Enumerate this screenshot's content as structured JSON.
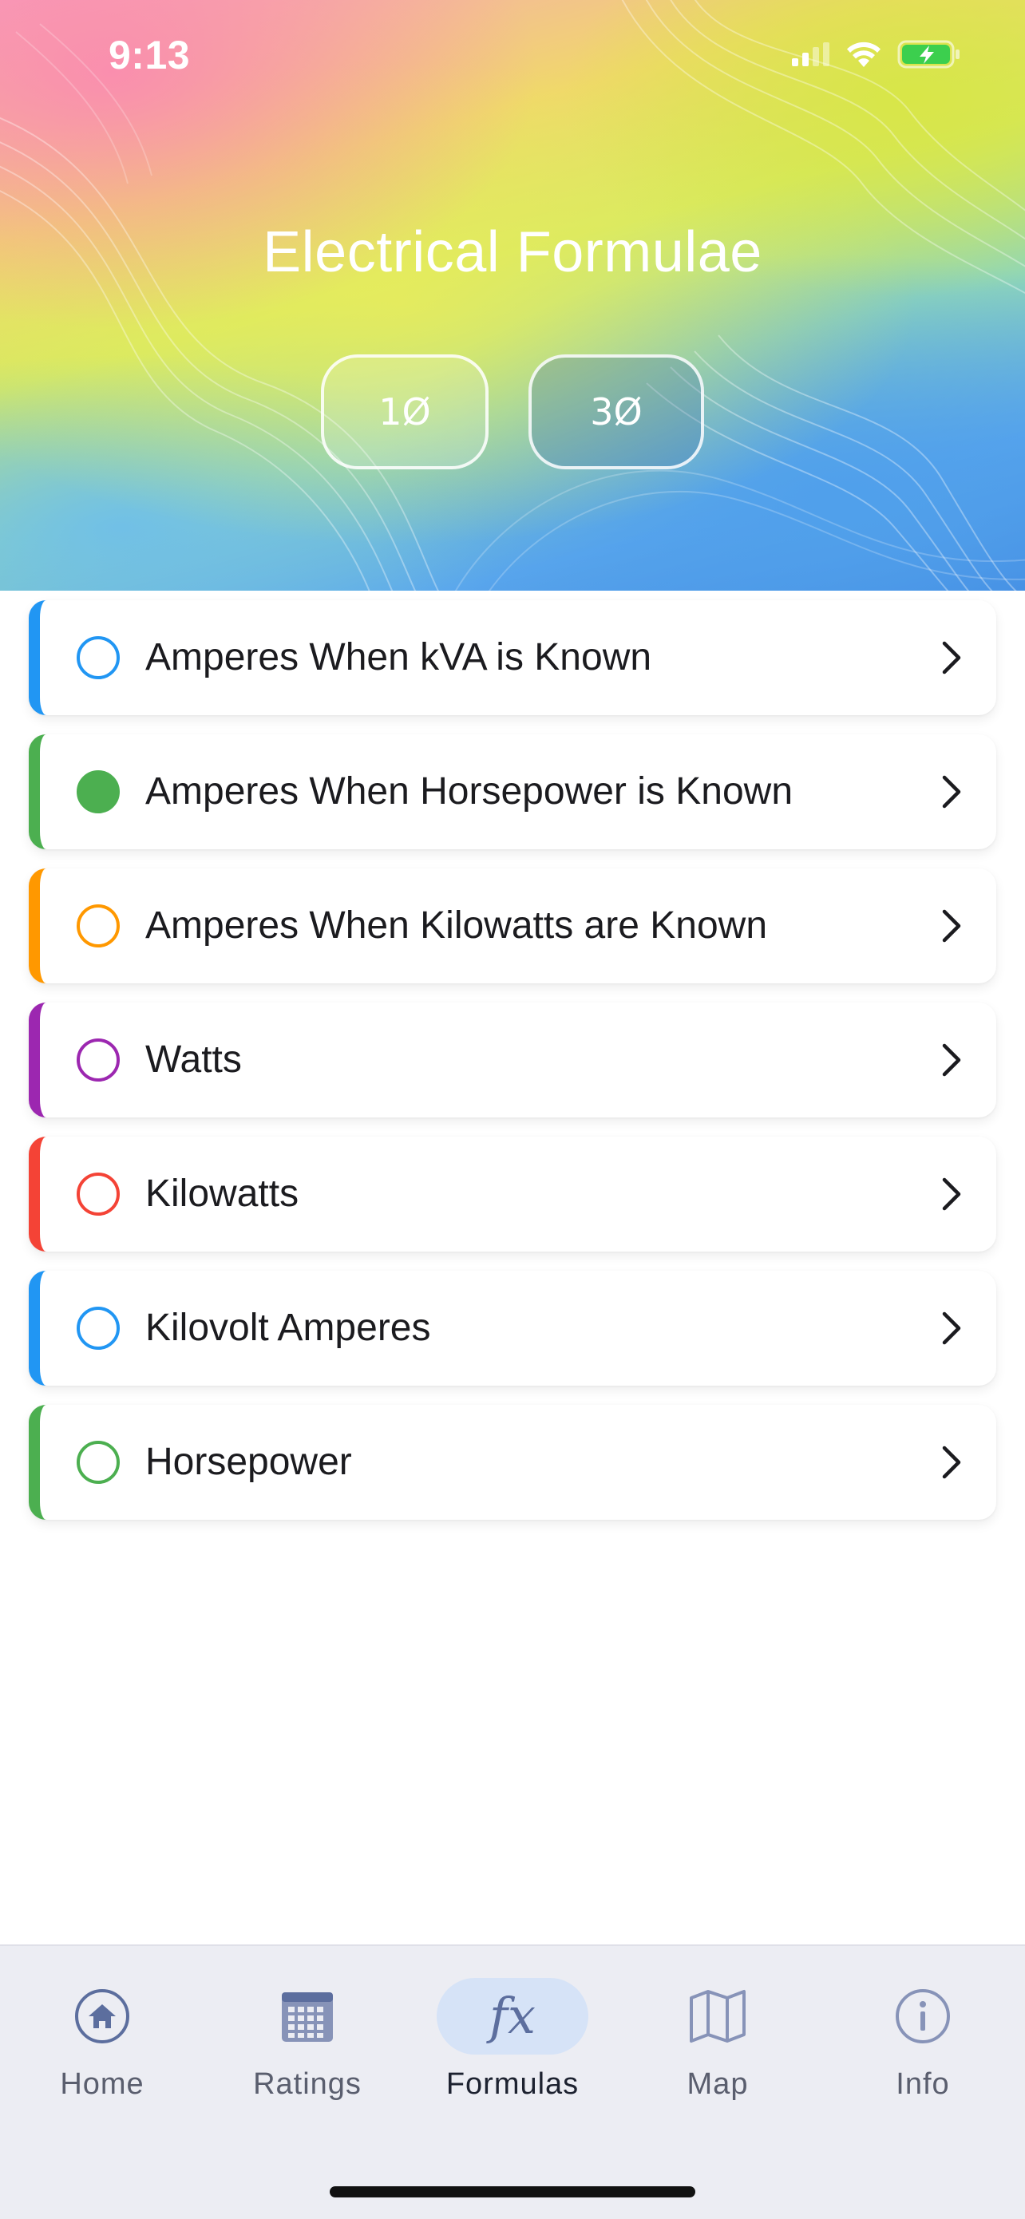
{
  "status_bar": {
    "time": "9:13"
  },
  "header": {
    "title": "Electrical Formulae",
    "phase_buttons": [
      {
        "label": "1Ø"
      },
      {
        "label": "3Ø"
      }
    ]
  },
  "formulas": [
    {
      "label": "Amperes When kVA is Known",
      "color": "#2196f3",
      "selected": false
    },
    {
      "label": "Amperes When Horsepower is Known",
      "color": "#4caf50",
      "selected": true
    },
    {
      "label": "Amperes When Kilowatts are Known",
      "color": "#ff9800",
      "selected": false
    },
    {
      "label": "Watts",
      "color": "#9c27b0",
      "selected": false
    },
    {
      "label": "Kilowatts",
      "color": "#f44336",
      "selected": false
    },
    {
      "label": "Kilovolt Amperes",
      "color": "#2196f3",
      "selected": false
    },
    {
      "label": "Horsepower",
      "color": "#4caf50",
      "selected": false
    }
  ],
  "bottom_nav": {
    "active": "Formulas",
    "items": [
      {
        "label": "Home",
        "icon": "home-icon"
      },
      {
        "label": "Ratings",
        "icon": "calendar-grid-icon"
      },
      {
        "label": "Formulas",
        "icon": "fx-icon"
      },
      {
        "label": "Map",
        "icon": "map-icon"
      },
      {
        "label": "Info",
        "icon": "info-icon"
      }
    ]
  },
  "colors": {
    "accent_active_pill": "#d6e3f7",
    "nav_background": "#ecedf3",
    "nav_icon": "#5c6e9e"
  }
}
